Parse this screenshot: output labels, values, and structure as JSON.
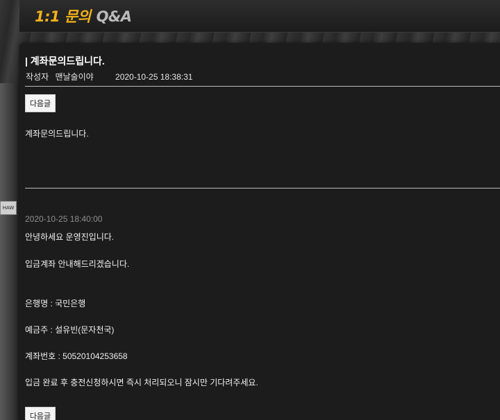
{
  "header": {
    "title_num": "1:1 문의",
    "title_qa": "Q&A"
  },
  "background": {
    "logo_fragment": "HAW"
  },
  "post": {
    "title": "| 계좌문의드립니다.",
    "author_label": "작성자",
    "author_name": "맨날술이야",
    "date": "2020-10-25 18:38:31",
    "next_button": "다음글",
    "body": "계좌문의드립니다."
  },
  "reply": {
    "date": "2020-10-25 18:40:00",
    "greeting": "안녕하세요 운영진입니다.",
    "intro": "입금계좌 안내해드리겠습니다.",
    "bank": "은행명 : 국민은행",
    "holder": "예금주 : 설유빈(문자천국)",
    "account": "계좌번호 : 50520104253658",
    "notice": "입금 완료 후 충전신청하시면 즉시 처리되오니 잠시만 기다려주세요.",
    "next_button": "다음글"
  }
}
